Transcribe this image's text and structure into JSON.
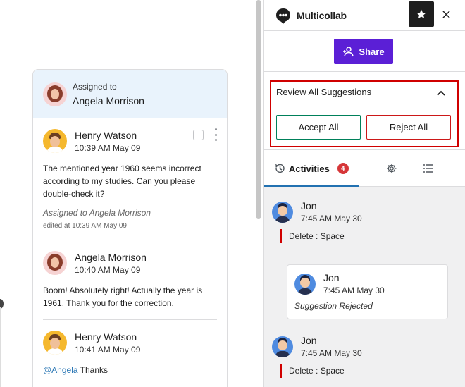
{
  "comment_thread": {
    "assigned_label": "Assigned to",
    "assigned_name": "Angela Morrison",
    "comments": [
      {
        "author": "Henry Watson",
        "time": "10:39 AM May 09",
        "body": "The mentioned year 1960 seems incorrect according to my studies. Can you please double-check it?",
        "assigned_note": "Assigned to Angela Morrison",
        "edited_note": "edited at 10:39 AM May 09"
      },
      {
        "author": "Angela Morrison",
        "time": "10:40 AM May 09",
        "body": "Boom! Absolutely right! Actually the year is 1961. Thank you for the correction."
      },
      {
        "author": "Henry Watson",
        "time": "10:41 AM May 09",
        "mention": "@Angela",
        "body": " Thanks"
      }
    ]
  },
  "panel": {
    "app_title": "Multicollab",
    "share_label": "Share",
    "review": {
      "title": "Review All Suggestions",
      "accept_label": "Accept All",
      "reject_label": "Reject All"
    },
    "tabs": {
      "activities_label": "Activities",
      "activities_count": "4"
    },
    "activities": [
      {
        "author": "Jon",
        "time": "7:45 AM May 30",
        "action": "Delete : Space",
        "reply": {
          "author": "Jon",
          "time": "7:45 AM May 30",
          "status": "Suggestion Rejected"
        }
      },
      {
        "author": "Jon",
        "time": "7:45 AM May 30",
        "action": "Delete : Space"
      }
    ]
  },
  "colors": {
    "accent_purple": "#5b1fd6",
    "highlight_red": "#d00000",
    "accept_green": "#00805a",
    "tab_blue": "#2271b1",
    "assigned_bg": "#e9f3fc"
  }
}
